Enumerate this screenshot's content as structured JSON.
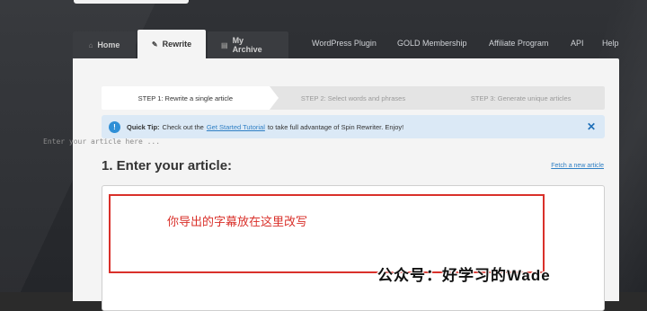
{
  "nav": {
    "tabs": [
      {
        "icon": "home-icon",
        "label": "Home"
      },
      {
        "icon": "pencil-icon",
        "label": "Rewrite"
      },
      {
        "icon": "archive-icon",
        "label": "My Archive"
      }
    ],
    "links": [
      "WordPress Plugin",
      "GOLD Membership",
      "Affiliate Program",
      "API",
      "Help"
    ]
  },
  "steps": [
    "STEP 1: Rewrite a single article",
    "STEP 2: Select words and phrases",
    "STEP 3: Generate unique articles"
  ],
  "tip": {
    "title": "Quick Tip:",
    "text_before": "Check out the",
    "link": "Get Started Tutorial",
    "text_after": "to take full advantage of Spin Rewriter. Enjoy!"
  },
  "article": {
    "heading": "1. Enter your article:",
    "fetch_link": "Fetch a new article",
    "placeholder": "Enter your article here ..."
  },
  "annotation": "你导出的字幕放在这里改写",
  "watermark": "公众号：好学习的Wade",
  "colors": {
    "accent": "#2f7fc4",
    "annotation_red": "#d9302a",
    "tip_bg": "#dbe9f6"
  }
}
